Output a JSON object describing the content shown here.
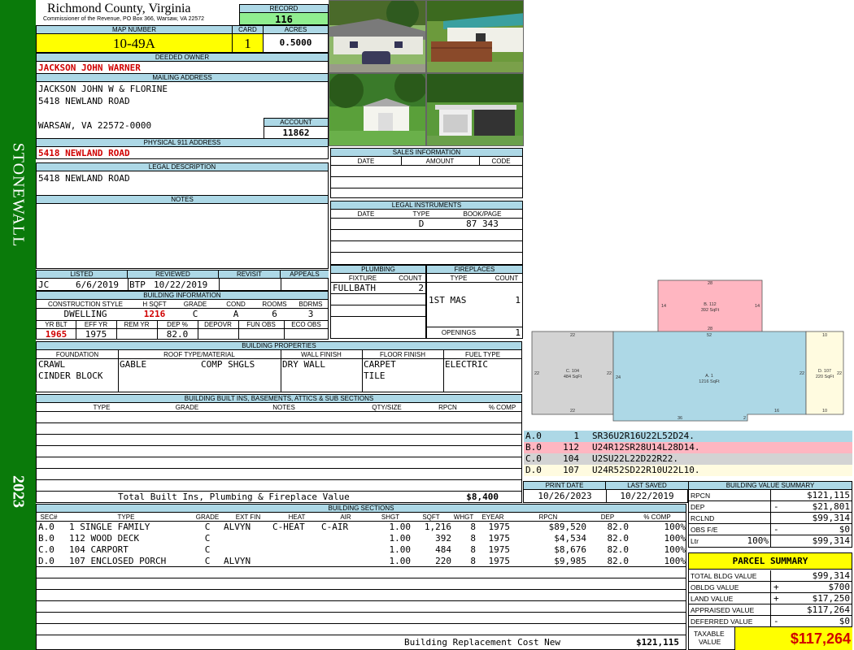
{
  "sidebar": {
    "district": "STONEWALL",
    "year": "2023",
    "color": "#0a7a0a"
  },
  "header": {
    "county": "Richmond County, Virginia",
    "commissioner": "Commissioner of the Revenue, PO Box 366, Warsaw, VA 22572",
    "record_label": "RECORD",
    "record": "116",
    "map_label": "MAP NUMBER",
    "map_number": "10-49A",
    "card_label": "CARD",
    "card": "1",
    "acres_label": "ACRES",
    "acres": "0.5000"
  },
  "owner": {
    "label": "DEEDED OWNER",
    "name": "JACKSON JOHN WARNER"
  },
  "mailing": {
    "label": "MAILING ADDRESS",
    "line1": "JACKSON JOHN W & FLORINE",
    "line2": "5418 NEWLAND ROAD",
    "line3": "WARSAW, VA 22572-0000"
  },
  "account": {
    "label": "ACCOUNT",
    "value": "11862"
  },
  "physical": {
    "label": "PHYSICAL 911 ADDRESS",
    "value": "5418 NEWLAND ROAD"
  },
  "legal_desc": {
    "label": "LEGAL DESCRIPTION",
    "value": "5418 NEWLAND ROAD"
  },
  "notes": {
    "label": "NOTES"
  },
  "sales": {
    "label": "SALES INFORMATION",
    "cols": [
      "DATE",
      "AMOUNT",
      "CODE"
    ]
  },
  "instruments": {
    "label": "LEGAL INSTRUMENTS",
    "cols": [
      "DATE",
      "TYPE",
      "BOOK/PAGE"
    ],
    "type": "D",
    "bookpage": "87 343"
  },
  "review": {
    "listed_label": "LISTED",
    "reviewed_label": "REVIEWED",
    "revisit_label": "REVISIT",
    "appeals_label": "APPEALS",
    "listed_by": "JC",
    "listed_date": "6/6/2019",
    "reviewed_by": "BTP",
    "reviewed_date": "10/22/2019"
  },
  "plumbing": {
    "label": "PLUMBING",
    "fixture_label": "FIXTURE",
    "count_label": "COUNT",
    "fixture": "FULLBATH",
    "count": "2"
  },
  "fireplaces": {
    "label": "FIREPLACES",
    "type_label": "TYPE",
    "count_label": "COUNT",
    "type": "1ST MAS",
    "count": "1",
    "openings_label": "OPENINGS",
    "openings": "1"
  },
  "building_info": {
    "label": "BUILDING INFORMATION",
    "cols1": [
      "CONSTRUCTION STYLE",
      "H SQFT",
      "GRADE",
      "COND",
      "ROOMS",
      "BDRMS"
    ],
    "style": "DWELLING",
    "hsqft": "1216",
    "grade": "C",
    "cond": "A",
    "rooms": "6",
    "bdrms": "3",
    "cols2": [
      "YR BLT",
      "EFF YR",
      "REM YR",
      "DEP %",
      "DEPOVR",
      "FUN OBS",
      "ECO OBS"
    ],
    "yrblt": "1965",
    "effyr": "1975",
    "dep": "82.0"
  },
  "properties": {
    "label": "BUILDING PROPERTIES",
    "cols": [
      "FOUNDATION",
      "ROOF TYPE/MATERIAL",
      "WALL FINISH",
      "FLOOR FINISH",
      "FUEL TYPE"
    ],
    "foundation1": "CRAWL",
    "foundation2": "CINDER BLOCK",
    "roof1": "GABLE",
    "roof2": "COMP SHGLS",
    "wall": "DRY WALL",
    "floor1": "CARPET",
    "floor2": "TILE",
    "fuel": "ELECTRIC"
  },
  "builtins": {
    "label": "BUILDING BUILT INS, BASEMENTS, ATTICS & SUB SECTIONS",
    "cols": [
      "TYPE",
      "GRADE",
      "NOTES",
      "QTY/SIZE",
      "RPCN",
      "% COMP"
    ],
    "total_label": "Total Built Ins, Plumbing & Fireplace Value",
    "total": "$8,400"
  },
  "sections": {
    "label": "BUILDING SECTIONS",
    "cols": [
      "SEC#",
      "TYPE",
      "GRADE",
      "EXT FIN",
      "HEAT",
      "AIR",
      "SHGT",
      "SQFT",
      "WHGT",
      "EYEAR",
      "RPCN",
      "DEP",
      "% COMP"
    ],
    "rows": [
      {
        "sec": "A.0",
        "type": "1 SINGLE FAMILY",
        "grade": "C",
        "ext": "ALVYN",
        "heat": "C-HEAT",
        "air": "C-AIR",
        "shgt": "1.00",
        "sqft": "1,216",
        "whgt": "8",
        "eyear": "1975",
        "rpcn": "$89,520",
        "dep": "82.0",
        "comp": "100%"
      },
      {
        "sec": "B.0",
        "type": "112 WOOD DECK",
        "grade": "C",
        "ext": "",
        "heat": "",
        "air": "",
        "shgt": "1.00",
        "sqft": "392",
        "whgt": "8",
        "eyear": "1975",
        "rpcn": "$4,534",
        "dep": "82.0",
        "comp": "100%"
      },
      {
        "sec": "C.0",
        "type": "104 CARPORT",
        "grade": "C",
        "ext": "",
        "heat": "",
        "air": "",
        "shgt": "1.00",
        "sqft": "484",
        "whgt": "8",
        "eyear": "1975",
        "rpcn": "$8,676",
        "dep": "82.0",
        "comp": "100%"
      },
      {
        "sec": "D.0",
        "type": "107 ENCLOSED PORCH",
        "grade": "C",
        "ext": "ALVYN",
        "heat": "",
        "air": "",
        "shgt": "1.00",
        "sqft": "220",
        "whgt": "8",
        "eyear": "1975",
        "rpcn": "$9,985",
        "dep": "82.0",
        "comp": "100%"
      }
    ],
    "replacement_label": "Building Replacement Cost New",
    "replacement": "$121,115"
  },
  "sketch": {
    "b_label": "B. 112",
    "b_sqft": "392 SqFt",
    "c_label": "C. 104",
    "c_sqft": "484 SqFt",
    "a_label": "A. 1",
    "a_sqft": "1216 SqFt",
    "d_label": "D. 107",
    "d_sqft": "220 SqFt",
    "dims": {
      "b_top": "28",
      "b_left": "14",
      "b_right": "14",
      "b_bot": "28",
      "c_top": "22",
      "c_left": "22",
      "c_right": "22",
      "c_bot": "22",
      "a_top": "52",
      "a_left": "24",
      "a_right": "22",
      "a_bot": "36",
      "a_bot2": "16",
      "a_step": "2",
      "d_top": "10",
      "d_right": "22",
      "d_bot": "10"
    },
    "colors": {
      "a": "#add8e6",
      "b": "#ffb6c1",
      "c": "#d3d3d3",
      "d": "#fffbe0"
    }
  },
  "vectors": [
    {
      "id": "A.0",
      "num": "1",
      "code": "SR36U2R16U22L52D24.",
      "color": "#add8e6"
    },
    {
      "id": "B.0",
      "num": "112",
      "code": "U24R12SR28U14L28D14.",
      "color": "#ffb6c1"
    },
    {
      "id": "C.0",
      "num": "104",
      "code": "U2SU22L22D22R22.",
      "color": "#d3d3d3"
    },
    {
      "id": "D.0",
      "num": "107",
      "code": "U24R52SD22R10U22L10.",
      "color": "#fffbe0"
    }
  ],
  "dates": {
    "print_label": "PRINT DATE",
    "print": "10/26/2023",
    "saved_label": "LAST SAVED",
    "saved": "10/22/2019"
  },
  "value_summary": {
    "label": "BUILDING VALUE SUMMARY",
    "rpcn_label": "RPCN",
    "rpcn": "$121,115",
    "dep_label": "DEP",
    "dep_sign": "-",
    "dep": "$21,801",
    "rclnd_label": "RCLND",
    "rclnd": "$99,314",
    "obs_label": "OBS F/E",
    "obs_sign": "-",
    "obs": "$0",
    "ltr_label": "Ltr",
    "ltr_pct": "100%",
    "ltr": "$99,314"
  },
  "parcel": {
    "label": "PARCEL SUMMARY",
    "total_bldg_label": "TOTAL BLDG VALUE",
    "total_bldg": "$99,314",
    "obldg_label": "OBLDG VALUE",
    "obldg_sign": "+",
    "obldg": "$700",
    "land_label": "LAND VALUE",
    "land_sign": "+",
    "land": "$17,250",
    "appraised_label": "APPRAISED VALUE",
    "appraised": "$117,264",
    "deferred_label": "DEFERRED VALUE",
    "deferred_sign": "-",
    "deferred": "$0",
    "taxable_label1": "TAXABLE",
    "taxable_label2": "VALUE",
    "taxable": "$117,264"
  }
}
